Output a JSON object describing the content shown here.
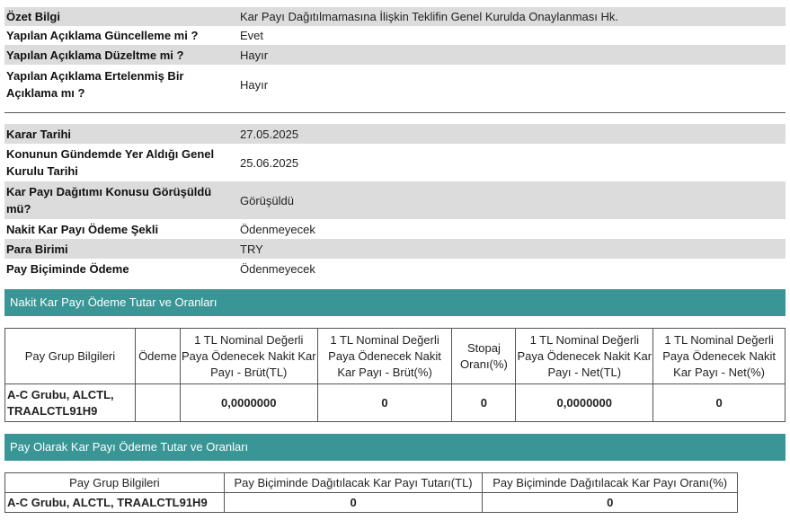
{
  "general": {
    "summary_label": "Özet Bilgi",
    "summary_value": "Kar Payı Dağıtılmamasına İlişkin Teklifin Genel Kurulda Onaylanması Hk.",
    "update_label": "Yapılan Açıklama Güncelleme mi ?",
    "update_value": "Evet",
    "correction_label": "Yapılan Açıklama Düzeltme mi ?",
    "correction_value": "Hayır",
    "deferred_label_1": "Yapılan Açıklama Ertelenmiş Bir",
    "deferred_label_2": "Açıklama mı ?",
    "deferred_value": "Hayır"
  },
  "details": {
    "decision_date_label": "Karar Tarihi",
    "decision_date_value": "27.05.2025",
    "agenda_label_1": "Konunun Gündemde Yer Aldığı Genel",
    "agenda_label_2": "Kurulu Tarihi",
    "agenda_value": "25.06.2025",
    "discussed_label_1": "Kar Payı Dağıtımı Konusu Görüşüldü",
    "discussed_label_2": "mü?",
    "discussed_value": "Görüşüldü",
    "payment_type_label": "Nakit Kar Payı Ödeme Şekli",
    "payment_type_value": "Ödenmeyecek",
    "currency_label": "Para Birimi",
    "currency_value": "TRY",
    "share_payment_label": "Pay Biçiminde Ödeme",
    "share_payment_value": "Ödenmeyecek"
  },
  "cash_section": {
    "title": "Nakit Kar Payı Ödeme Tutar ve Oranları",
    "headers": [
      "Pay Grup Bilgileri",
      "Ödeme",
      "1 TL Nominal Değerli Paya Ödenecek Nakit Kar Payı - Brüt(TL)",
      "1 TL Nominal Değerli Paya Ödenecek Nakit Kar Payı - Brüt(%)",
      "Stopaj Oranı(%)",
      "1 TL Nominal Değerli Paya Ödenecek Nakit Kar Payı - Net(TL)",
      "1 TL Nominal Değerli Paya Ödenecek Nakit Kar Payı - Net(%)"
    ],
    "row": {
      "group": "A-C Grubu, ALCTL, TRAALCTL91H9",
      "payment": "",
      "gross_tl": "0,0000000",
      "gross_pct": "0",
      "withholding": "0",
      "net_tl": "0,0000000",
      "net_pct": "0"
    }
  },
  "share_section": {
    "title": "Pay Olarak Kar Payı Ödeme Tutar ve Oranları",
    "headers": [
      "Pay Grup Bilgileri",
      "Pay Biçiminde Dağıtılacak Kar Payı Tutarı(TL)",
      "Pay Biçiminde Dağıtılacak Kar Payı Oranı(%)"
    ],
    "row": {
      "group": "A-C Grubu, ALCTL, TRAALCTL91H9",
      "amount": "0",
      "ratio": "0"
    }
  }
}
